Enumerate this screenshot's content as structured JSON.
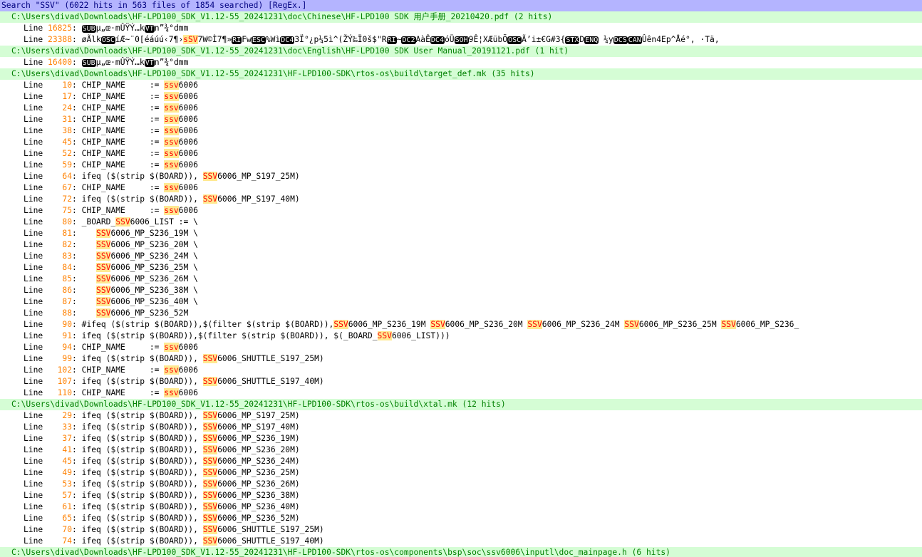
{
  "search_header": "Search \"SSV\" (6022 hits in 563 files of 1854 searched) [RegEx.]",
  "line_label": "Line",
  "rows": [
    {
      "type": "file",
      "text": "C:\\Users\\divad\\Downloads\\HF-LPD100_SDK_V1.12-55_20241231\\doc\\Chinese\\HF-LPD100 SDK 用户手册_20210420.pdf (2 hits)"
    },
    {
      "type": "line",
      "num": "16825",
      "parts": [
        {
          "k": "c",
          "t": "SUB"
        },
        {
          "k": "t",
          "t": "µ„œ·mÛŸÝ…k"
        },
        {
          "k": "c",
          "t": "VT"
        },
        {
          "k": "t",
          "t": "n”¾°dmm"
        }
      ]
    },
    {
      "type": "line",
      "num": "23388",
      "parts": [
        {
          "k": "t",
          "t": "øÃlk"
        },
        {
          "k": "c",
          "t": "OSC"
        },
        {
          "k": "t",
          "t": "íÆ~¨0[éáúú‹7¶›"
        },
        {
          "k": "m",
          "t": "sSV"
        },
        {
          "k": "t",
          "t": "7W©Ì7¶»"
        },
        {
          "k": "c",
          "t": "RI"
        },
        {
          "k": "t",
          "t": "Fw"
        },
        {
          "k": "c",
          "t": "ESC"
        },
        {
          "k": "t",
          "t": "%Wì"
        },
        {
          "k": "c",
          "t": "DC4"
        },
        {
          "k": "t",
          "t": "3Ï°¿p¼5ì^(ŽÝ‰Ï0š$\"R"
        },
        {
          "k": "c",
          "t": "RI"
        },
        {
          "k": "t",
          "t": "~"
        },
        {
          "k": "c",
          "t": "DC2"
        },
        {
          "k": "t",
          "t": "AàÊ"
        },
        {
          "k": "c",
          "t": "DC4"
        },
        {
          "k": "t",
          "t": "óÜ"
        },
        {
          "k": "c",
          "t": "SOH"
        },
        {
          "k": "t",
          "t": "9Ê¦XÆübÕ"
        },
        {
          "k": "c",
          "t": "OSC"
        },
        {
          "k": "t",
          "t": "Ã’i±€G#3{"
        },
        {
          "k": "c",
          "t": "STX"
        },
        {
          "k": "t",
          "t": "D"
        },
        {
          "k": "c",
          "t": "ENQ"
        },
        {
          "k": "t",
          "t": " ¼y"
        },
        {
          "k": "c",
          "t": "DCS"
        },
        {
          "k": "c",
          "t": "CAN"
        },
        {
          "k": "t",
          "t": "Ûên4Ep^Åé°, ·Tä,"
        }
      ]
    },
    {
      "type": "file",
      "text": "C:\\Users\\divad\\Downloads\\HF-LPD100_SDK_V1.12-55_20241231\\doc\\English\\HF-LPD100 SDK User Manual_20191121.pdf (1 hit)"
    },
    {
      "type": "line",
      "num": "16400",
      "parts": [
        {
          "k": "c",
          "t": "SUB"
        },
        {
          "k": "t",
          "t": "µ„œ·mÛŸÝ…k"
        },
        {
          "k": "c",
          "t": "VT"
        },
        {
          "k": "t",
          "t": "n”¾°dmm"
        }
      ]
    },
    {
      "type": "file",
      "text": "C:\\Users\\divad\\Downloads\\HF-LPD100_SDK_V1.12-55_20241231\\HF-LPD100-SDK\\rtos-os\\build\\target_def.mk (35 hits)"
    },
    {
      "type": "line",
      "num": "10",
      "parts": [
        {
          "k": "t",
          "t": "CHIP_NAME     := "
        },
        {
          "k": "m",
          "t": "ssv"
        },
        {
          "k": "t",
          "t": "6006"
        }
      ]
    },
    {
      "type": "line",
      "num": "17",
      "parts": [
        {
          "k": "t",
          "t": "CHIP_NAME     := "
        },
        {
          "k": "m",
          "t": "ssv"
        },
        {
          "k": "t",
          "t": "6006"
        }
      ]
    },
    {
      "type": "line",
      "num": "24",
      "parts": [
        {
          "k": "t",
          "t": "CHIP_NAME     := "
        },
        {
          "k": "m",
          "t": "ssv"
        },
        {
          "k": "t",
          "t": "6006"
        }
      ]
    },
    {
      "type": "line",
      "num": "31",
      "parts": [
        {
          "k": "t",
          "t": "CHIP_NAME     := "
        },
        {
          "k": "m",
          "t": "ssv"
        },
        {
          "k": "t",
          "t": "6006"
        }
      ]
    },
    {
      "type": "line",
      "num": "38",
      "parts": [
        {
          "k": "t",
          "t": "CHIP_NAME     := "
        },
        {
          "k": "m",
          "t": "ssv"
        },
        {
          "k": "t",
          "t": "6006"
        }
      ]
    },
    {
      "type": "line",
      "num": "45",
      "parts": [
        {
          "k": "t",
          "t": "CHIP_NAME     := "
        },
        {
          "k": "m",
          "t": "ssv"
        },
        {
          "k": "t",
          "t": "6006"
        }
      ]
    },
    {
      "type": "line",
      "num": "52",
      "parts": [
        {
          "k": "t",
          "t": "CHIP_NAME     := "
        },
        {
          "k": "m",
          "t": "ssv"
        },
        {
          "k": "t",
          "t": "6006"
        }
      ]
    },
    {
      "type": "line",
      "num": "59",
      "parts": [
        {
          "k": "t",
          "t": "CHIP_NAME     := "
        },
        {
          "k": "m",
          "t": "ssv"
        },
        {
          "k": "t",
          "t": "6006"
        }
      ]
    },
    {
      "type": "line",
      "num": "64",
      "parts": [
        {
          "k": "t",
          "t": "ifeq ($(strip $(BOARD)), "
        },
        {
          "k": "m",
          "t": "SSV"
        },
        {
          "k": "t",
          "t": "6006_MP_S197_25M)"
        }
      ]
    },
    {
      "type": "line",
      "num": "67",
      "parts": [
        {
          "k": "t",
          "t": "CHIP_NAME     := "
        },
        {
          "k": "m",
          "t": "ssv"
        },
        {
          "k": "t",
          "t": "6006"
        }
      ]
    },
    {
      "type": "line",
      "num": "72",
      "parts": [
        {
          "k": "t",
          "t": "ifeq ($(strip $(BOARD)), "
        },
        {
          "k": "m",
          "t": "SSV"
        },
        {
          "k": "t",
          "t": "6006_MP_S197_40M)"
        }
      ]
    },
    {
      "type": "line",
      "num": "75",
      "parts": [
        {
          "k": "t",
          "t": "CHIP_NAME     := "
        },
        {
          "k": "m",
          "t": "ssv"
        },
        {
          "k": "t",
          "t": "6006"
        }
      ]
    },
    {
      "type": "line",
      "num": "80",
      "parts": [
        {
          "k": "t",
          "t": "_BOARD_"
        },
        {
          "k": "m",
          "t": "SSV"
        },
        {
          "k": "t",
          "t": "6006_LIST := \\"
        }
      ]
    },
    {
      "type": "line",
      "num": "81",
      "parts": [
        {
          "k": "t",
          "t": "   "
        },
        {
          "k": "m",
          "t": "SSV"
        },
        {
          "k": "t",
          "t": "6006_MP_S236_19M \\"
        }
      ]
    },
    {
      "type": "line",
      "num": "82",
      "parts": [
        {
          "k": "t",
          "t": "   "
        },
        {
          "k": "m",
          "t": "SSV"
        },
        {
          "k": "t",
          "t": "6006_MP_S236_20M \\"
        }
      ]
    },
    {
      "type": "line",
      "num": "83",
      "parts": [
        {
          "k": "t",
          "t": "   "
        },
        {
          "k": "m",
          "t": "SSV"
        },
        {
          "k": "t",
          "t": "6006_MP_S236_24M \\"
        }
      ]
    },
    {
      "type": "line",
      "num": "84",
      "parts": [
        {
          "k": "t",
          "t": "   "
        },
        {
          "k": "m",
          "t": "SSV"
        },
        {
          "k": "t",
          "t": "6006_MP_S236_25M \\"
        }
      ]
    },
    {
      "type": "line",
      "num": "85",
      "parts": [
        {
          "k": "t",
          "t": "   "
        },
        {
          "k": "m",
          "t": "SSV"
        },
        {
          "k": "t",
          "t": "6006_MP_S236_26M \\"
        }
      ]
    },
    {
      "type": "line",
      "num": "86",
      "parts": [
        {
          "k": "t",
          "t": "   "
        },
        {
          "k": "m",
          "t": "SSV"
        },
        {
          "k": "t",
          "t": "6006_MP_S236_38M \\"
        }
      ]
    },
    {
      "type": "line",
      "num": "87",
      "parts": [
        {
          "k": "t",
          "t": "   "
        },
        {
          "k": "m",
          "t": "SSV"
        },
        {
          "k": "t",
          "t": "6006_MP_S236_40M \\"
        }
      ]
    },
    {
      "type": "line",
      "num": "88",
      "parts": [
        {
          "k": "t",
          "t": "   "
        },
        {
          "k": "m",
          "t": "SSV"
        },
        {
          "k": "t",
          "t": "6006_MP_S236_52M"
        }
      ]
    },
    {
      "type": "line",
      "num": "90",
      "parts": [
        {
          "k": "t",
          "t": "#ifeq ($(strip $(BOARD)),$(filter $(strip $(BOARD)),"
        },
        {
          "k": "m",
          "t": "SSV"
        },
        {
          "k": "t",
          "t": "6006_MP_S236_19M "
        },
        {
          "k": "m",
          "t": "SSV"
        },
        {
          "k": "t",
          "t": "6006_MP_S236_20M "
        },
        {
          "k": "m",
          "t": "SSV"
        },
        {
          "k": "t",
          "t": "6006_MP_S236_24M "
        },
        {
          "k": "m",
          "t": "SSV"
        },
        {
          "k": "t",
          "t": "6006_MP_S236_25M "
        },
        {
          "k": "m",
          "t": "SSV"
        },
        {
          "k": "t",
          "t": "6006_MP_S236_"
        }
      ]
    },
    {
      "type": "line",
      "num": "91",
      "parts": [
        {
          "k": "t",
          "t": "ifeq ($(strip $(BOARD)),$(filter $(strip $(BOARD)), $(_BOARD_"
        },
        {
          "k": "m",
          "t": "SSV"
        },
        {
          "k": "t",
          "t": "6006_LIST)))"
        }
      ]
    },
    {
      "type": "line",
      "num": "94",
      "parts": [
        {
          "k": "t",
          "t": "CHIP_NAME     := "
        },
        {
          "k": "m",
          "t": "ssv"
        },
        {
          "k": "t",
          "t": "6006"
        }
      ]
    },
    {
      "type": "line",
      "num": "99",
      "parts": [
        {
          "k": "t",
          "t": "ifeq ($(strip $(BOARD)), "
        },
        {
          "k": "m",
          "t": "SSV"
        },
        {
          "k": "t",
          "t": "6006_SHUTTLE_S197_25M)"
        }
      ]
    },
    {
      "type": "line",
      "num": "102",
      "parts": [
        {
          "k": "t",
          "t": "CHIP_NAME     := "
        },
        {
          "k": "m",
          "t": "ssv"
        },
        {
          "k": "t",
          "t": "6006"
        }
      ]
    },
    {
      "type": "line",
      "num": "107",
      "parts": [
        {
          "k": "t",
          "t": "ifeq ($(strip $(BOARD)), "
        },
        {
          "k": "m",
          "t": "SSV"
        },
        {
          "k": "t",
          "t": "6006_SHUTTLE_S197_40M)"
        }
      ]
    },
    {
      "type": "line",
      "num": "110",
      "parts": [
        {
          "k": "t",
          "t": "CHIP_NAME     := "
        },
        {
          "k": "m",
          "t": "ssv"
        },
        {
          "k": "t",
          "t": "6006"
        }
      ]
    },
    {
      "type": "file",
      "text": "C:\\Users\\divad\\Downloads\\HF-LPD100_SDK_V1.12-55_20241231\\HF-LPD100-SDK\\rtos-os\\build\\xtal.mk (12 hits)"
    },
    {
      "type": "line",
      "num": "29",
      "parts": [
        {
          "k": "t",
          "t": "ifeq ($(strip $(BOARD)), "
        },
        {
          "k": "m",
          "t": "SSV"
        },
        {
          "k": "t",
          "t": "6006_MP_S197_25M)"
        }
      ]
    },
    {
      "type": "line",
      "num": "33",
      "parts": [
        {
          "k": "t",
          "t": "ifeq ($(strip $(BOARD)), "
        },
        {
          "k": "m",
          "t": "SSV"
        },
        {
          "k": "t",
          "t": "6006_MP_S197_40M)"
        }
      ]
    },
    {
      "type": "line",
      "num": "37",
      "parts": [
        {
          "k": "t",
          "t": "ifeq ($(strip $(BOARD)), "
        },
        {
          "k": "m",
          "t": "SSV"
        },
        {
          "k": "t",
          "t": "6006_MP_S236_19M)"
        }
      ]
    },
    {
      "type": "line",
      "num": "41",
      "parts": [
        {
          "k": "t",
          "t": "ifeq ($(strip $(BOARD)), "
        },
        {
          "k": "m",
          "t": "SSV"
        },
        {
          "k": "t",
          "t": "6006_MP_S236_20M)"
        }
      ]
    },
    {
      "type": "line",
      "num": "45",
      "parts": [
        {
          "k": "t",
          "t": "ifeq ($(strip $(BOARD)), "
        },
        {
          "k": "m",
          "t": "SSV"
        },
        {
          "k": "t",
          "t": "6006_MP_S236_24M)"
        }
      ]
    },
    {
      "type": "line",
      "num": "49",
      "parts": [
        {
          "k": "t",
          "t": "ifeq ($(strip $(BOARD)), "
        },
        {
          "k": "m",
          "t": "SSV"
        },
        {
          "k": "t",
          "t": "6006_MP_S236_25M)"
        }
      ]
    },
    {
      "type": "line",
      "num": "53",
      "parts": [
        {
          "k": "t",
          "t": "ifeq ($(strip $(BOARD)), "
        },
        {
          "k": "m",
          "t": "SSV"
        },
        {
          "k": "t",
          "t": "6006_MP_S236_26M)"
        }
      ]
    },
    {
      "type": "line",
      "num": "57",
      "parts": [
        {
          "k": "t",
          "t": "ifeq ($(strip $(BOARD)), "
        },
        {
          "k": "m",
          "t": "SSV"
        },
        {
          "k": "t",
          "t": "6006_MP_S236_38M)"
        }
      ]
    },
    {
      "type": "line",
      "num": "61",
      "parts": [
        {
          "k": "t",
          "t": "ifeq ($(strip $(BOARD)), "
        },
        {
          "k": "m",
          "t": "SSV"
        },
        {
          "k": "t",
          "t": "6006_MP_S236_40M)"
        }
      ]
    },
    {
      "type": "line",
      "num": "65",
      "parts": [
        {
          "k": "t",
          "t": "ifeq ($(strip $(BOARD)), "
        },
        {
          "k": "m",
          "t": "SSV"
        },
        {
          "k": "t",
          "t": "6006_MP_S236_52M)"
        }
      ]
    },
    {
      "type": "line",
      "num": "70",
      "parts": [
        {
          "k": "t",
          "t": "ifeq ($(strip $(BOARD)), "
        },
        {
          "k": "m",
          "t": "SSV"
        },
        {
          "k": "t",
          "t": "6006_SHUTTLE_S197_25M)"
        }
      ]
    },
    {
      "type": "line",
      "num": "74",
      "parts": [
        {
          "k": "t",
          "t": "ifeq ($(strip $(BOARD)), "
        },
        {
          "k": "m",
          "t": "SSV"
        },
        {
          "k": "t",
          "t": "6006_SHUTTLE_S197_40M)"
        }
      ]
    },
    {
      "type": "file",
      "text": "C:\\Users\\divad\\Downloads\\HF-LPD100_SDK_V1.12-55_20241231\\HF-LPD100-SDK\\rtos-os\\components\\bsp\\soc\\ssv6006\\inputl\\doc_mainpage.h (6 hits)"
    }
  ]
}
